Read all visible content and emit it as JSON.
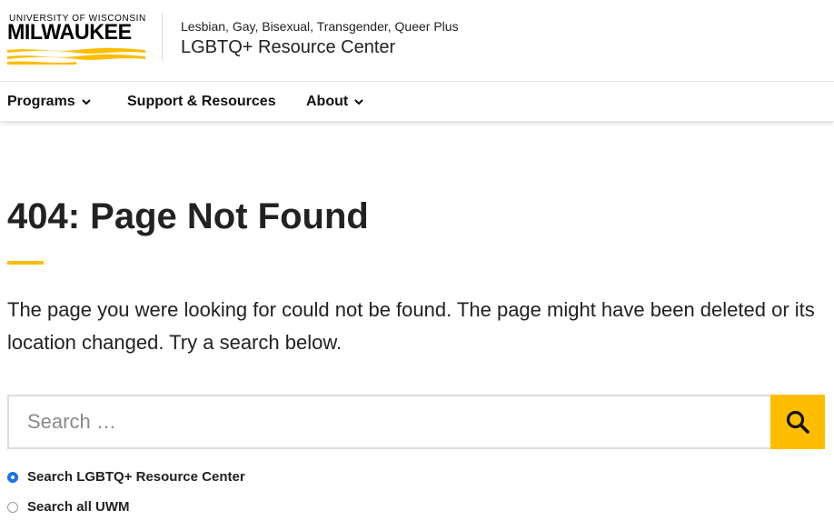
{
  "header": {
    "logo": {
      "top_text": "UNIVERSITY OF WISCONSIN",
      "main_text": "MILWAUKEE"
    },
    "subtitle": "Lesbian, Gay, Bisexual, Transgender, Queer Plus",
    "title": "LGBTQ+ Resource Center"
  },
  "nav": {
    "items": [
      {
        "label": "Programs",
        "has_dropdown": true
      },
      {
        "label": "Support & Resources",
        "has_dropdown": false
      },
      {
        "label": "About",
        "has_dropdown": true
      }
    ]
  },
  "main": {
    "title": "404: Page Not Found",
    "message": "The page you were looking for could not be found. The page might have been deleted or its location changed. Try a search below."
  },
  "search": {
    "placeholder": "Search …",
    "value": "",
    "button_icon": "search-icon",
    "options": [
      {
        "label": "Search LGBTQ+ Resource Center",
        "checked": true
      },
      {
        "label": "Search all UWM",
        "checked": false
      }
    ]
  },
  "colors": {
    "accent": "#ffbd00",
    "text": "#222222",
    "radio_selected": "#1a73e8"
  }
}
